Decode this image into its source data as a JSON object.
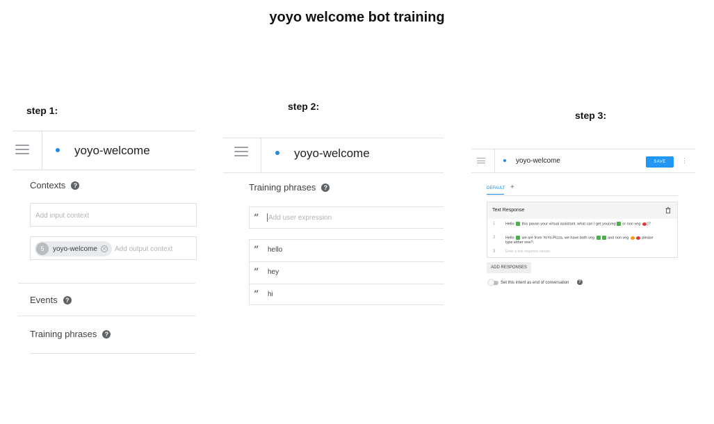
{
  "title": "yoyo welcome bot training",
  "step1": {
    "label": "step 1:",
    "intent_name": "yoyo-welcome",
    "contexts_title": "Contexts",
    "input_context_placeholder": "Add input context",
    "output_chip_lifespan": "5",
    "output_chip_name": "yoyo-welcome",
    "output_context_placeholder": "Add output context",
    "events_title": "Events",
    "training_title": "Training phrases"
  },
  "step2": {
    "label": "step 2:",
    "intent_name": "yoyo-welcome",
    "training_title": "Training phrases",
    "add_expression_placeholder": "Add user expression",
    "phrases": [
      "hello",
      "hey",
      "hi"
    ]
  },
  "step3": {
    "label": "step 3:",
    "intent_name": "yoyo-welcome",
    "save_label": "SAVE",
    "tab_default": "DEFAULT",
    "tab_add": "+",
    "text_response_title": "Text Response",
    "responses": [
      {
        "num": "1",
        "text_a": "Hello",
        "text_b": "this pavan your virtual assistant. what can I get  you(veg",
        "text_c": " or non veg",
        "text_d": ")?"
      },
      {
        "num": "2",
        "text_a": "Hello",
        "text_b": " we are from YoYo-Pizza, we have both veg",
        "text_c": "  and non veg",
        "text_d": "please type either one?."
      }
    ],
    "row3_num": "3",
    "enter_variant_placeholder": "Enter a text response variant",
    "add_responses_label": "ADD RESPONSES",
    "end_conversation_label": "Set this intent as end of conversation"
  },
  "icons": {
    "menu": "hamburger-menu-icon",
    "help": "help-circle-icon",
    "quote": "quote-icon",
    "trash": "trash-icon",
    "more": "more-vertical-icon",
    "chip_close": "close-circle-icon"
  },
  "colors": {
    "accent": "#1e88e5",
    "save_button": "#2196f3",
    "divider": "#e0e0e0"
  }
}
